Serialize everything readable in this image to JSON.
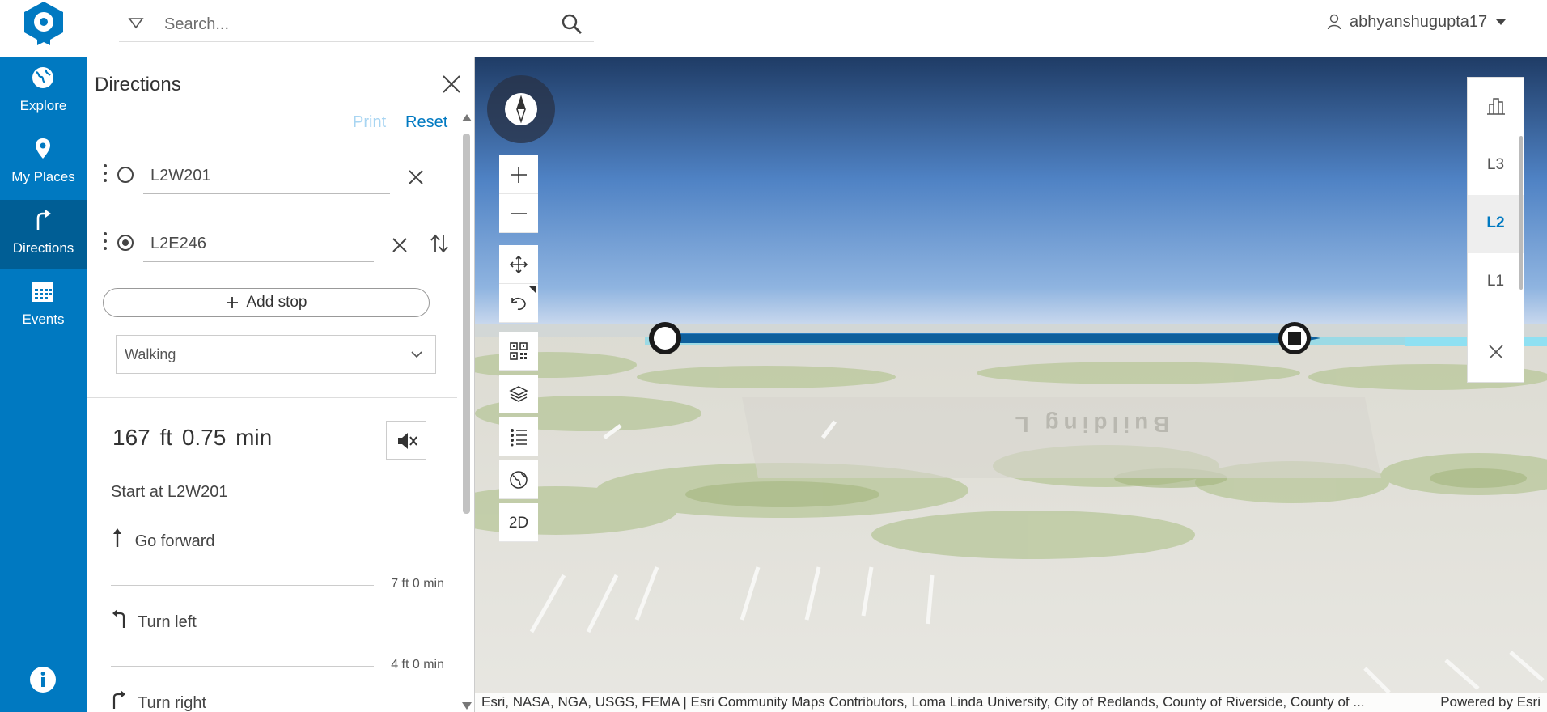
{
  "header": {
    "search_placeholder": "Search...",
    "username": "abhyanshugupta17"
  },
  "nav": {
    "items": [
      {
        "label": "Explore",
        "icon": "globe-icon"
      },
      {
        "label": "My Places",
        "icon": "pin-icon"
      },
      {
        "label": "Directions",
        "icon": "turn-right-icon",
        "active": true
      },
      {
        "label": "Events",
        "icon": "calendar-icon"
      }
    ]
  },
  "directions": {
    "title": "Directions",
    "print_label": "Print",
    "reset_label": "Reset",
    "origin": "L2W201",
    "destination": "L2E246",
    "add_stop_label": "Add stop",
    "travel_mode": "Walking",
    "summary": "167 ft  0.75 min",
    "steps": [
      {
        "text": "Start at L2W201"
      },
      {
        "text": "Go forward",
        "icon": "arrow-up-icon",
        "segment": "7 ft  0 min"
      },
      {
        "text": "Turn left",
        "icon": "turn-left-icon",
        "segment": "4 ft  0 min"
      },
      {
        "text": "Turn right",
        "icon": "turn-right-icon"
      }
    ]
  },
  "map": {
    "floors": [
      "L3",
      "L2",
      "L1"
    ],
    "active_floor": "L2",
    "view_toggle_label": "2D",
    "ground_label": "Building L",
    "attribution": "Esri, NASA, NGA, USGS, FEMA | Esri Community Maps Contributors, Loma Linda University, City of Redlands, County of Riverside, County of ...",
    "powered_by": "Powered by Esri",
    "route_color": "#0e5f9c",
    "brand_color": "#0079c1"
  }
}
